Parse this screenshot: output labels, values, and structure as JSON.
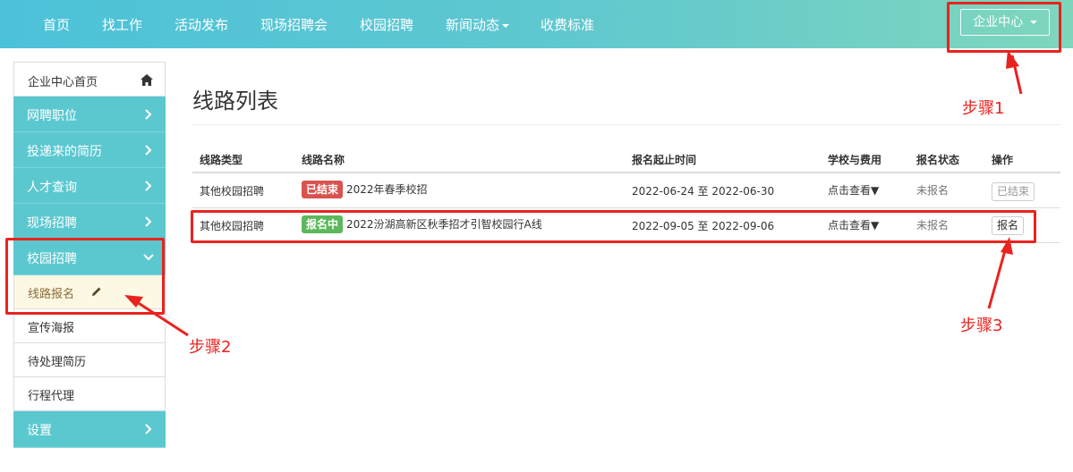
{
  "topnav": {
    "items": [
      "首页",
      "找工作",
      "活动发布",
      "现场招聘会",
      "校园招聘",
      "新闻动态",
      "收费标准"
    ],
    "enterprise_center": "企业中心"
  },
  "sidebar": {
    "home": "企业中心首页",
    "items": [
      "网聘职位",
      "投递来的简历",
      "人才查询",
      "现场招聘",
      "校园招聘"
    ],
    "sub_items": [
      "线路报名",
      "宣传海报",
      "待处理简历",
      "行程代理"
    ],
    "settings": "设置"
  },
  "main": {
    "title": "线路列表",
    "columns": [
      "线路类型",
      "线路名称",
      "报名起止时间",
      "学校与费用",
      "报名状态",
      "操作"
    ],
    "rows": [
      {
        "type": "其他校园招聘",
        "badge": "已结束",
        "name": "2022年春季校招",
        "period": "2022-06-24 至 2022-06-30",
        "school": "点击查看▼",
        "status": "未报名",
        "action": "已结束"
      },
      {
        "type": "其他校园招聘",
        "badge": "报名中",
        "name": "2022汾湖高新区秋季招才引智校园行A线",
        "period": "2022-09-05 至 2022-09-06",
        "school": "点击查看▼",
        "status": "未报名",
        "action": "报名"
      }
    ]
  },
  "annotations": {
    "step1": "步骤1",
    "step2": "步骤2",
    "step3": "步骤3"
  },
  "colors": {
    "nav_gradient_start": "#4cc2d9",
    "nav_gradient_end": "#7fd6bd",
    "sidebar_item": "#5bc8d0",
    "annotation_red": "#e8231f",
    "badge_ended": "#d9534f",
    "badge_open": "#5cb85c"
  }
}
